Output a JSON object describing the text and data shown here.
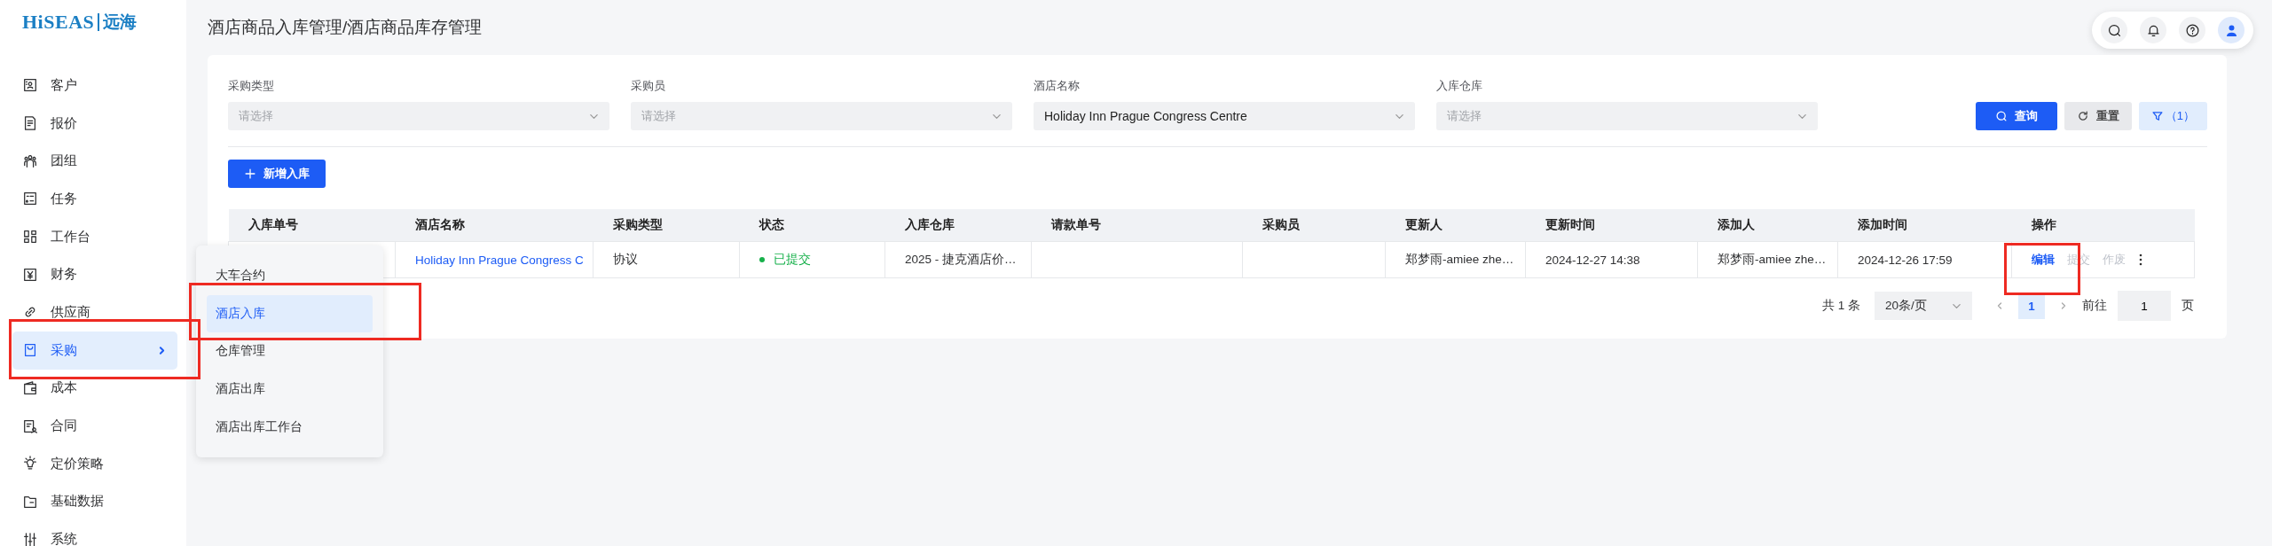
{
  "logo": {
    "brand": "HiSEAS",
    "name": "远海"
  },
  "sidebar": {
    "items": [
      {
        "label": "客户",
        "selected": false,
        "has_submenu": false
      },
      {
        "label": "报价",
        "selected": false,
        "has_submenu": false
      },
      {
        "label": "团组",
        "selected": false,
        "has_submenu": false
      },
      {
        "label": "任务",
        "selected": false,
        "has_submenu": false
      },
      {
        "label": "工作台",
        "selected": false,
        "has_submenu": false
      },
      {
        "label": "财务",
        "selected": false,
        "has_submenu": false
      },
      {
        "label": "供应商",
        "selected": false,
        "has_submenu": false
      },
      {
        "label": "采购",
        "selected": true,
        "has_submenu": true
      },
      {
        "label": "成本",
        "selected": false,
        "has_submenu": false
      },
      {
        "label": "合同",
        "selected": false,
        "has_submenu": false
      },
      {
        "label": "定价策略",
        "selected": false,
        "has_submenu": false
      },
      {
        "label": "基础数据",
        "selected": false,
        "has_submenu": false
      },
      {
        "label": "系统",
        "selected": false,
        "has_submenu": false
      }
    ]
  },
  "submenu": {
    "items": [
      {
        "label": "大车合约",
        "selected": false
      },
      {
        "label": "酒店入库",
        "selected": true
      },
      {
        "label": "仓库管理",
        "selected": false
      },
      {
        "label": "酒店出库",
        "selected": false
      },
      {
        "label": "酒店出库工作台",
        "selected": false
      }
    ]
  },
  "page_title": "酒店商品入库管理/酒店商品库存管理",
  "filters": [
    {
      "label": "采购类型",
      "placeholder": "请选择"
    },
    {
      "label": "采购员",
      "placeholder": "请选择"
    },
    {
      "label": "酒店名称",
      "value": "Holiday Inn Prague Congress Centre"
    },
    {
      "label": "入库仓库",
      "placeholder": "请选择"
    }
  ],
  "buttons": {
    "query": "查询",
    "reset": "重置",
    "filter": "（1）"
  },
  "add_button": "新增入库",
  "table": {
    "columns": [
      "入库单号",
      "酒店名称",
      "采购类型",
      "状态",
      "入库仓库",
      "请款单号",
      "采购员",
      "更新人",
      "更新时间",
      "添加人",
      "添加时间",
      "操作"
    ],
    "rows": [
      {
        "cells": [
          {
            "kind": "empty"
          },
          {
            "kind": "link",
            "text": "Holiday Inn Prague Congress C"
          },
          {
            "kind": "text",
            "text": "协议"
          },
          {
            "kind": "status",
            "text": "已提交",
            "color": "#16b04a"
          },
          {
            "kind": "text",
            "text": "2025 - 捷克酒店价…"
          },
          {
            "kind": "empty"
          },
          {
            "kind": "empty"
          },
          {
            "kind": "text",
            "text": "郑梦雨-amiee zhe…"
          },
          {
            "kind": "text",
            "text": "2024-12-27 14:38"
          },
          {
            "kind": "text",
            "text": "郑梦雨-amiee zhe…"
          },
          {
            "kind": "text",
            "text": "2024-12-26 17:59"
          },
          {
            "kind": "actions",
            "actions": [
              {
                "label": "编辑",
                "disabled": false
              },
              {
                "label": "提交",
                "disabled": true
              },
              {
                "label": "作废",
                "disabled": true
              }
            ]
          }
        ]
      }
    ]
  },
  "pagination": {
    "total": "共 1 条",
    "page_size": "20条/页",
    "pages": [
      {
        "label": "1",
        "selected": true
      }
    ],
    "goto_label": "前往",
    "goto_value": "1",
    "goto_suffix": "页"
  }
}
